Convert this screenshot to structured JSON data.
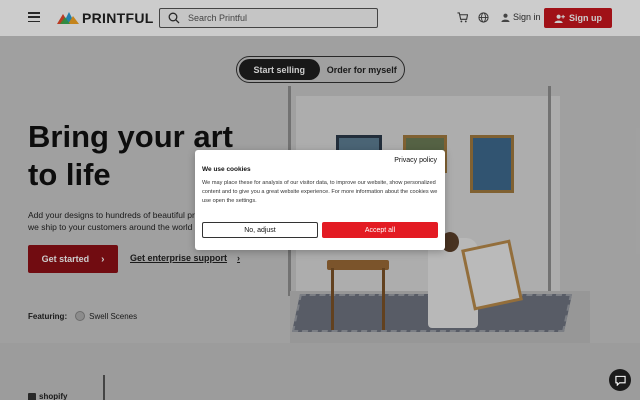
{
  "header": {
    "logo_text": "PRINTFUL",
    "search_placeholder": "Search Printful",
    "signin_label": "Sign in",
    "signup_label": "Sign up",
    "accent_color": "#c8161d"
  },
  "hero": {
    "toggle": {
      "active": "Start selling",
      "inactive": "Order for myself"
    },
    "title_line1": "Bring your art",
    "title_line2": "to life",
    "subtitle": "Add your designs to hundreds of beautiful produ we ship to your customers around the world",
    "get_started": "Get started",
    "enterprise": "Get enterprise support",
    "featuring_label": "Featuring:",
    "featuring_brand": "Swell Scenes"
  },
  "logos": {
    "shopify": "shopify"
  },
  "cookie": {
    "privacy_link": "Privacy policy",
    "title": "We use cookies",
    "text": "We may place these for analysis of our visitor data, to improve our website, show personalized content and to give you a great website experience. For more information about the cookies we use open the settings.",
    "adjust_label": "No, adjust",
    "accept_label": "Accept all",
    "accept_color": "#e31b23"
  },
  "icons": {
    "menu": "hamburger-menu-icon",
    "search": "search-icon",
    "cart": "cart-icon",
    "globe": "globe-icon",
    "user": "user-icon",
    "add_user": "add-user-icon",
    "chevron": "chevron-right-icon",
    "chat": "chat-icon"
  }
}
